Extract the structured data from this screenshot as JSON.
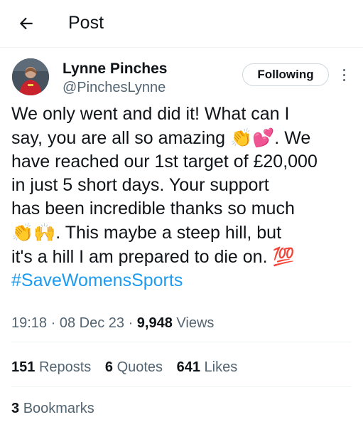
{
  "header": {
    "title": "Post",
    "back_icon": "arrow-left-icon"
  },
  "author": {
    "name": "Lynne Pinches",
    "handle": "@PinchesLynne",
    "follow_label": "Following",
    "more_icon": "more-vertical-icon"
  },
  "tweet": {
    "lines": [
      {
        "text": "We only went and did it! What can I",
        "emoji": ""
      },
      {
        "text": "say,  you are all so amazing ",
        "emoji": "👏💕",
        "suffix": ".  We"
      },
      {
        "text": "have reached our 1st target of £20,000",
        "emoji": ""
      },
      {
        "text": "in just 5 short days. Your support",
        "emoji": ""
      },
      {
        "text": "has been incredible thanks so much",
        "emoji": ""
      },
      {
        "text": "",
        "emoji": "👏🙌",
        "suffix": ". This maybe a steep hill, but"
      },
      {
        "text": "it's a hill I am prepared to die on. ",
        "emoji": "💯"
      }
    ],
    "hashtag": "#SaveWomensSports"
  },
  "meta": {
    "time": "19:18",
    "date": "08 Dec 23",
    "views_count": "9,948",
    "views_label": "Views"
  },
  "stats": {
    "reposts_count": "151",
    "reposts_label": "Reposts",
    "quotes_count": "6",
    "quotes_label": "Quotes",
    "likes_count": "641",
    "likes_label": "Likes",
    "bookmarks_count": "3",
    "bookmarks_label": "Bookmarks"
  },
  "colors": {
    "text": "#0f1419",
    "secondary": "#536471",
    "link": "#1d9bf0",
    "border": "#eff3f4"
  }
}
